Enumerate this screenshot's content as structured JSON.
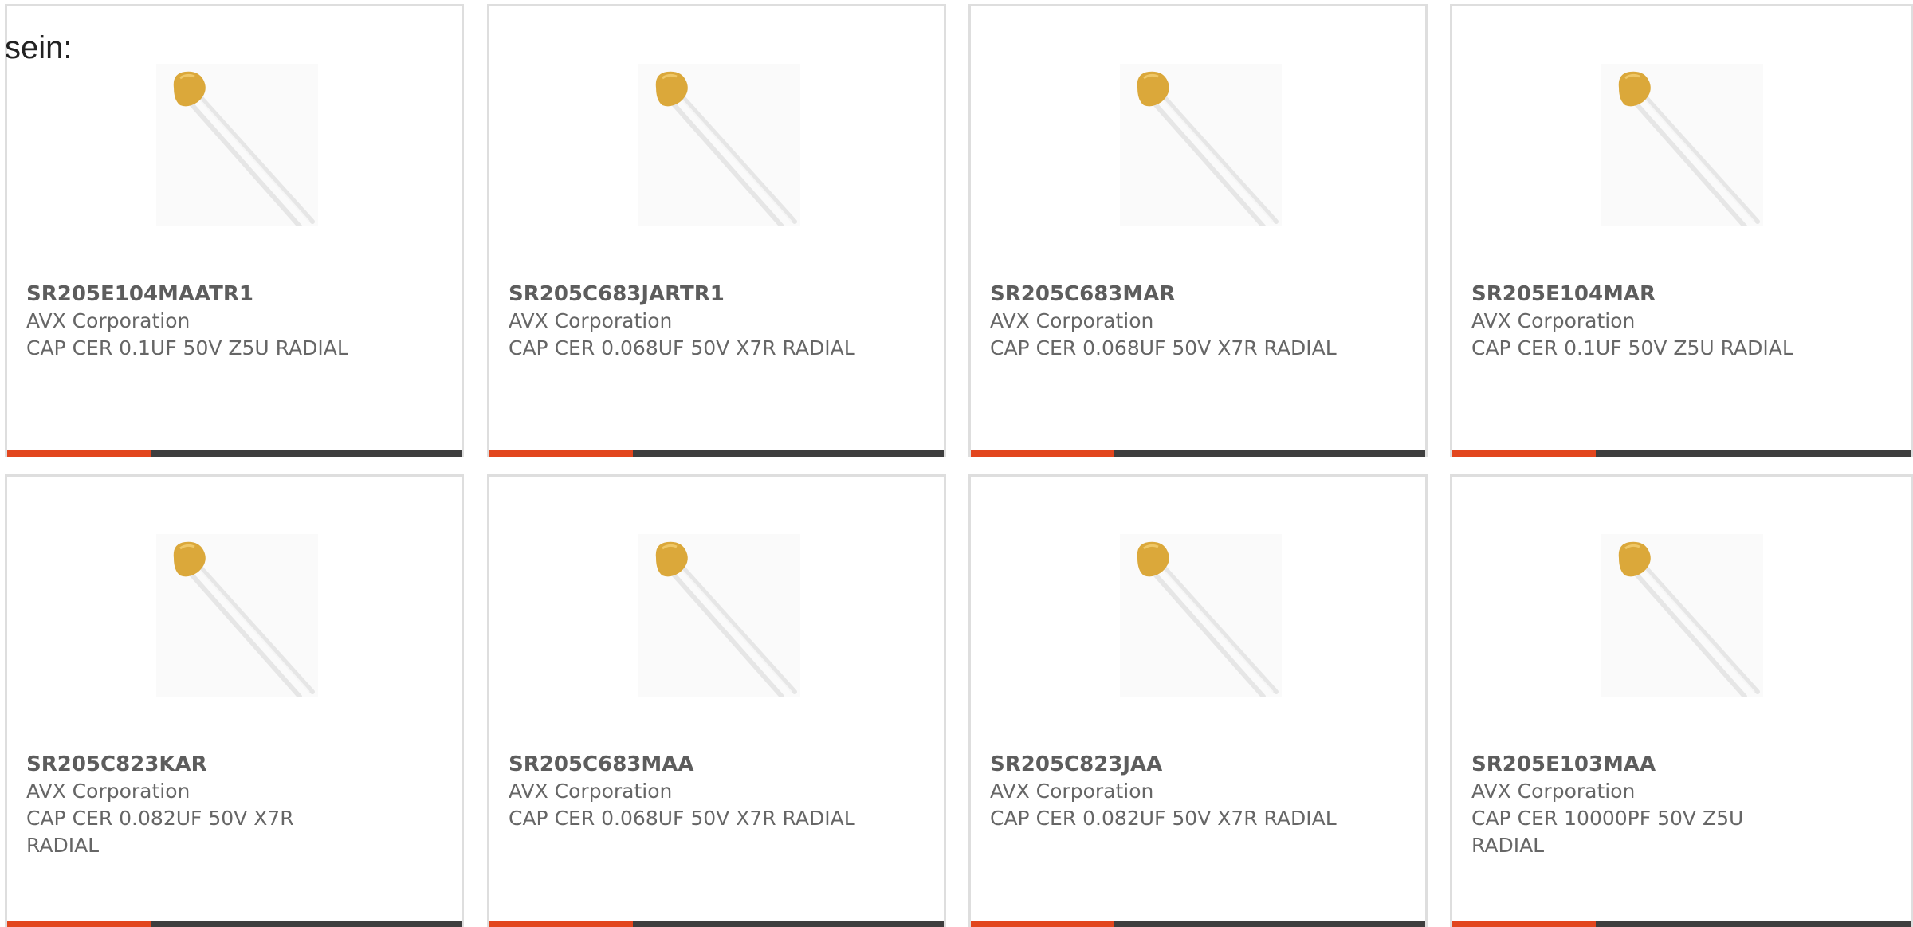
{
  "intro_text": "sein:",
  "colors": {
    "accent": "#e2461e",
    "bar": "#3e3e3e",
    "card_border": "#dedede",
    "text": "#666666",
    "capacitor_body": "#dba83a"
  },
  "products": [
    {
      "part": "SR205E104MAATR1",
      "manufacturer": "AVX Corporation",
      "description": "CAP CER 0.1UF 50V Z5U RADIAL",
      "image": "ceramic-capacitor-image"
    },
    {
      "part": "SR205C683JARTR1",
      "manufacturer": "AVX Corporation",
      "description": "CAP CER 0.068UF 50V X7R RADIAL",
      "image": "ceramic-capacitor-image"
    },
    {
      "part": "SR205C683MAR",
      "manufacturer": "AVX Corporation",
      "description": "CAP CER 0.068UF 50V X7R RADIAL",
      "image": "ceramic-capacitor-image"
    },
    {
      "part": "SR205E104MAR",
      "manufacturer": "AVX Corporation",
      "description": "CAP CER 0.1UF 50V Z5U RADIAL",
      "image": "ceramic-capacitor-image"
    },
    {
      "part": "SR205C823KAR",
      "manufacturer": "AVX Corporation",
      "description": "CAP CER 0.082UF 50V X7R RADIAL",
      "image": "ceramic-capacitor-image"
    },
    {
      "part": "SR205C683MAA",
      "manufacturer": "AVX Corporation",
      "description": "CAP CER 0.068UF 50V X7R RADIAL",
      "image": "ceramic-capacitor-image"
    },
    {
      "part": "SR205C823JAA",
      "manufacturer": "AVX Corporation",
      "description": "CAP CER 0.082UF 50V X7R RADIAL",
      "image": "ceramic-capacitor-image"
    },
    {
      "part": "SR205E103MAA",
      "manufacturer": "AVX Corporation",
      "description": "CAP CER 10000PF 50V Z5U RADIAL",
      "image": "ceramic-capacitor-image"
    }
  ]
}
